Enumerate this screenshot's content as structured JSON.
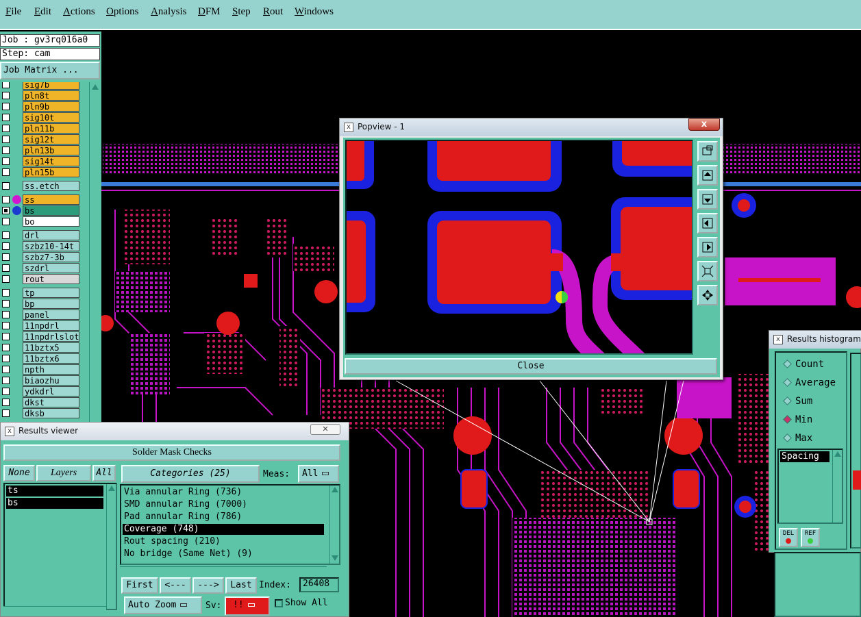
{
  "menu": {
    "items": [
      "File",
      "Edit",
      "Actions",
      "Options",
      "Analysis",
      "DFM",
      "Step",
      "Rout",
      "Windows"
    ]
  },
  "job": {
    "job_line": "Job : gv3rq016a0",
    "step_line": "Step: cam",
    "job_matrix_label": "Job Matrix ..."
  },
  "layers": [
    {
      "name": "sig7b",
      "color": "#f0b428",
      "checked": false,
      "dot": null
    },
    {
      "name": "pln8t",
      "color": "#f0b428",
      "checked": false,
      "dot": null
    },
    {
      "name": "pln9b",
      "color": "#f0b428",
      "checked": false,
      "dot": null
    },
    {
      "name": "sig10t",
      "color": "#f0b428",
      "checked": false,
      "dot": null
    },
    {
      "name": "pln11b",
      "color": "#f0b428",
      "checked": false,
      "dot": null
    },
    {
      "name": "sig12t",
      "color": "#f0b428",
      "checked": false,
      "dot": null
    },
    {
      "name": "pln13b",
      "color": "#f0b428",
      "checked": false,
      "dot": null
    },
    {
      "name": "sig14t",
      "color": "#f0b428",
      "checked": false,
      "dot": null
    },
    {
      "name": "pln15b",
      "color": "#f0b428",
      "checked": false,
      "dot": null
    },
    {
      "name": "ss.etch",
      "color": "#9fd8d2",
      "checked": false,
      "dot": null
    },
    {
      "name": "ss",
      "color": "#f0b428",
      "checked": false,
      "dot": "#d016d0"
    },
    {
      "name": "bs",
      "color": "#2d9c7a",
      "checked": true,
      "dot": "#1a3ad0"
    },
    {
      "name": "bo",
      "color": "#ffffff",
      "checked": false,
      "dot": null
    },
    {
      "name": "drl",
      "color": "#9fd8d2",
      "checked": false,
      "dot": null
    },
    {
      "name": "szbz10-14t",
      "color": "#9fd8d2",
      "checked": false,
      "dot": null
    },
    {
      "name": "szbz7-3b",
      "color": "#9fd8d2",
      "checked": false,
      "dot": null
    },
    {
      "name": "szdrl",
      "color": "#9fd8d2",
      "checked": false,
      "dot": null
    },
    {
      "name": "rout",
      "color": "#d8d8d8",
      "checked": false,
      "dot": null
    },
    {
      "name": "tp",
      "color": "#9fd8d2",
      "checked": false,
      "dot": null
    },
    {
      "name": "bp",
      "color": "#9fd8d2",
      "checked": false,
      "dot": null
    },
    {
      "name": "panel",
      "color": "#9fd8d2",
      "checked": false,
      "dot": null
    },
    {
      "name": "11npdrl",
      "color": "#9fd8d2",
      "checked": false,
      "dot": null
    },
    {
      "name": "11npdrlslot",
      "color": "#9fd8d2",
      "checked": false,
      "dot": null
    },
    {
      "name": "11bztx5",
      "color": "#9fd8d2",
      "checked": false,
      "dot": null
    },
    {
      "name": "11bztx6",
      "color": "#9fd8d2",
      "checked": false,
      "dot": null
    },
    {
      "name": "npth",
      "color": "#9fd8d2",
      "checked": false,
      "dot": null
    },
    {
      "name": "biaozhu",
      "color": "#9fd8d2",
      "checked": false,
      "dot": null
    },
    {
      "name": "ydkdrl",
      "color": "#9fd8d2",
      "checked": false,
      "dot": null
    },
    {
      "name": "dkst",
      "color": "#9fd8d2",
      "checked": false,
      "dot": null
    },
    {
      "name": "dksb",
      "color": "#9fd8d2",
      "checked": false,
      "dot": null
    }
  ],
  "popview": {
    "title": "Popview - 1",
    "close_x": "x",
    "close_label": "Close"
  },
  "results_viewer": {
    "title": "Results viewer",
    "heading": "Solder Mask Checks",
    "none_label": "None",
    "layers_label": "Layers",
    "all_label": "All",
    "layer_items": [
      "ts",
      "bs"
    ],
    "categories_label": "Categories (25)",
    "meas_label": "Meas:",
    "meas_value": "All",
    "categories": [
      "Via annular Ring (736)",
      "SMD annular Ring (7000)",
      "Pad annular Ring (786)",
      "Coverage (748)",
      "Rout spacing (210)",
      "No bridge (Same Net) (9)"
    ],
    "selected_category": 3,
    "first_label": "First",
    "prev_label": "<---",
    "next_label": "--->",
    "last_label": "Last",
    "index_label": "Index:",
    "index_value": "26408",
    "auto_zoom_label": "Auto Zoom",
    "sv_label": "Sv:",
    "sv_value": "!!",
    "show_all_label": "Show All"
  },
  "histogram": {
    "title": "Results histogram",
    "options": [
      "Count",
      "Average",
      "Sum",
      "Min",
      "Max"
    ],
    "selected": "Min",
    "list_item": "Spacing",
    "del_label": "DEL",
    "ref_label": "REF"
  },
  "colors": {
    "panel": "#5ec4a8",
    "button": "#96d3cf",
    "copper_pad": "#e01a1a",
    "mask_blue": "#1a22e0",
    "trace_magenta": "#c814c8"
  }
}
